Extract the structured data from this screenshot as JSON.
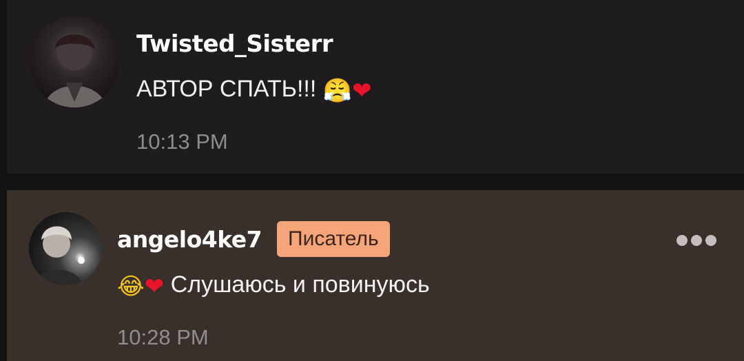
{
  "comments": [
    {
      "username": "Twisted_Sisterr",
      "message_text": "АВТОР СПАТЬ!!! ",
      "emojis": [
        "😤",
        "❤"
      ],
      "time": "10:13 PM"
    },
    {
      "username": "angelo4ke7",
      "badge": "Писатель",
      "emojis": [
        "😂",
        "❤"
      ],
      "message_text": " Слушаюсь и повинуюсь",
      "time": "10:28 PM",
      "more_icon": "more-horizontal-icon"
    }
  ],
  "colors": {
    "badge_background": "#f6a57a",
    "reply_background": "#3a302b",
    "comment_background": "#1e1c1e"
  }
}
